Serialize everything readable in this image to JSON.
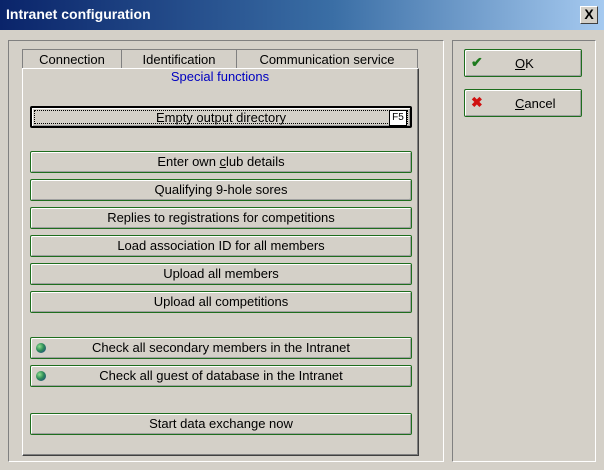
{
  "window": {
    "title": "Intranet configuration",
    "close_label": "X"
  },
  "tabs": [
    {
      "label": "Connection"
    },
    {
      "label": "Identification"
    },
    {
      "label": "Communication service"
    }
  ],
  "active_tab": {
    "label": "Special functions"
  },
  "buttons": {
    "empty_output": {
      "label": "Empty output directory",
      "shortcut": "F5"
    },
    "own_club": {
      "label_pre": "Enter own ",
      "label_ul": "c",
      "label_post": "lub details"
    },
    "qualifying": {
      "label": "Qualifying 9-hole sores"
    },
    "replies": {
      "label": "Replies to registrations for competitions"
    },
    "load_assoc": {
      "label": "Load association ID for all members"
    },
    "upload_members": {
      "label": "Upload all members"
    },
    "upload_comps": {
      "label": "Upload all competitions"
    },
    "check_secondary": {
      "label": "Check all secondary members in the Intranet",
      "icon": "globe-icon"
    },
    "check_guest": {
      "label": "Check all guest of database in the Intranet",
      "icon": "globe-icon"
    },
    "start_exchange": {
      "label": "Start data exchange now"
    }
  },
  "actions": {
    "ok": {
      "label_ul": "O",
      "label_post": "K",
      "icon": "check-icon",
      "icon_color": "#1e7a1e"
    },
    "cancel": {
      "label_ul": "C",
      "label_post": "ancel",
      "icon": "x-icon",
      "icon_color": "#d01010"
    }
  }
}
